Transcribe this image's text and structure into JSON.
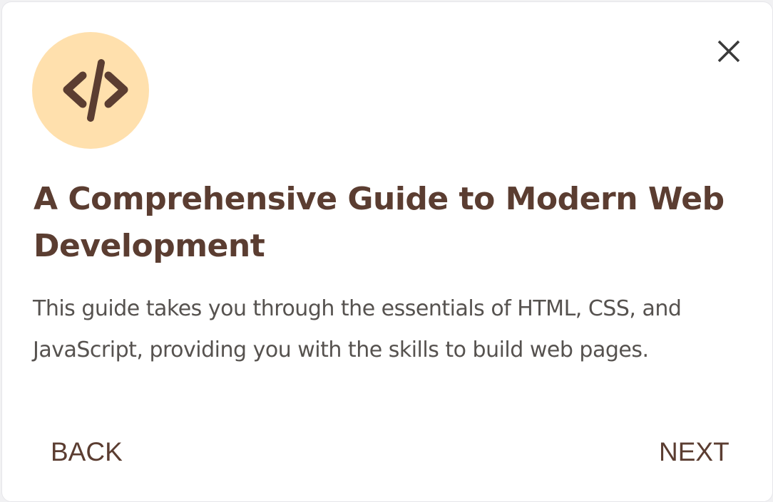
{
  "dialog": {
    "icon": "code-icon",
    "title": "A Comprehensive Guide to Modern Web Development",
    "description": "This guide takes you through the essentials of HTML, CSS, and JavaScript, providing you with the skills to build web pages.",
    "back_label": "BACK",
    "next_label": "NEXT",
    "close_icon": "close-icon"
  },
  "colors": {
    "accent": "#5b3d31",
    "icon_background": "#ffe0ad",
    "body_text": "#56524f",
    "card_background": "#ffffff"
  }
}
